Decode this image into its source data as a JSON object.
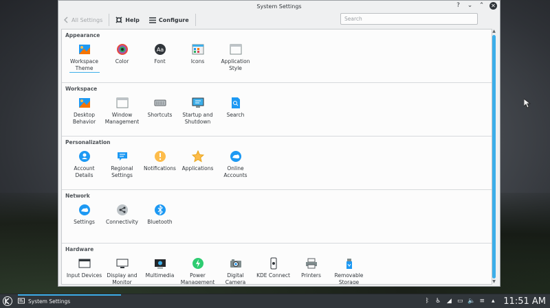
{
  "window": {
    "title": "System Settings",
    "controls": {
      "help": "?",
      "minimize": "⌄",
      "maximize": "⌃",
      "close": "✕"
    }
  },
  "toolbar": {
    "back_label": "All Settings",
    "help_label": "Help",
    "configure_label": "Configure",
    "search_placeholder": "Search",
    "search_value": ""
  },
  "sections": [
    {
      "title": "Appearance",
      "items": [
        {
          "label": "Workspace Theme",
          "icon": "workspace-theme-icon",
          "selected": true
        },
        {
          "label": "Color",
          "icon": "color-icon"
        },
        {
          "label": "Font",
          "icon": "font-icon"
        },
        {
          "label": "Icons",
          "icon": "icons-icon"
        },
        {
          "label": "Application Style",
          "icon": "application-style-icon"
        }
      ]
    },
    {
      "title": "Workspace",
      "items": [
        {
          "label": "Desktop Behavior",
          "icon": "desktop-behavior-icon"
        },
        {
          "label": "Window Management",
          "icon": "window-management-icon"
        },
        {
          "label": "Shortcuts",
          "icon": "shortcuts-icon"
        },
        {
          "label": "Startup and Shutdown",
          "icon": "startup-icon"
        },
        {
          "label": "Search",
          "icon": "search-settings-icon"
        }
      ]
    },
    {
      "title": "Personalization",
      "items": [
        {
          "label": "Account Details",
          "icon": "account-icon"
        },
        {
          "label": "Regional Settings",
          "icon": "regional-icon"
        },
        {
          "label": "Notifications",
          "icon": "notifications-icon"
        },
        {
          "label": "Applications",
          "icon": "applications-icon"
        },
        {
          "label": "Online Accounts",
          "icon": "online-accounts-icon"
        }
      ]
    },
    {
      "title": "Network",
      "items": [
        {
          "label": "Settings",
          "icon": "network-settings-icon"
        },
        {
          "label": "Connectivity",
          "icon": "connectivity-icon"
        },
        {
          "label": "Bluetooth",
          "icon": "bluetooth-icon"
        }
      ]
    },
    {
      "title": "Hardware",
      "items": [
        {
          "label": "Input Devices",
          "icon": "input-devices-icon"
        },
        {
          "label": "Display and Monitor",
          "icon": "display-icon"
        },
        {
          "label": "Multimedia",
          "icon": "multimedia-icon"
        },
        {
          "label": "Power Management",
          "icon": "power-icon"
        },
        {
          "label": "Digital Camera",
          "icon": "camera-icon"
        },
        {
          "label": "KDE Connect",
          "icon": "kde-connect-icon"
        },
        {
          "label": "Printers",
          "icon": "printer-icon"
        },
        {
          "label": "Removable Storage",
          "icon": "storage-icon"
        }
      ]
    }
  ],
  "taskbar": {
    "task_label": "System Settings",
    "clock": "11:51 AM"
  },
  "colors": {
    "accent": "#3daee9",
    "taskbar": "#31363b",
    "window_bg": "#eff0f1"
  }
}
